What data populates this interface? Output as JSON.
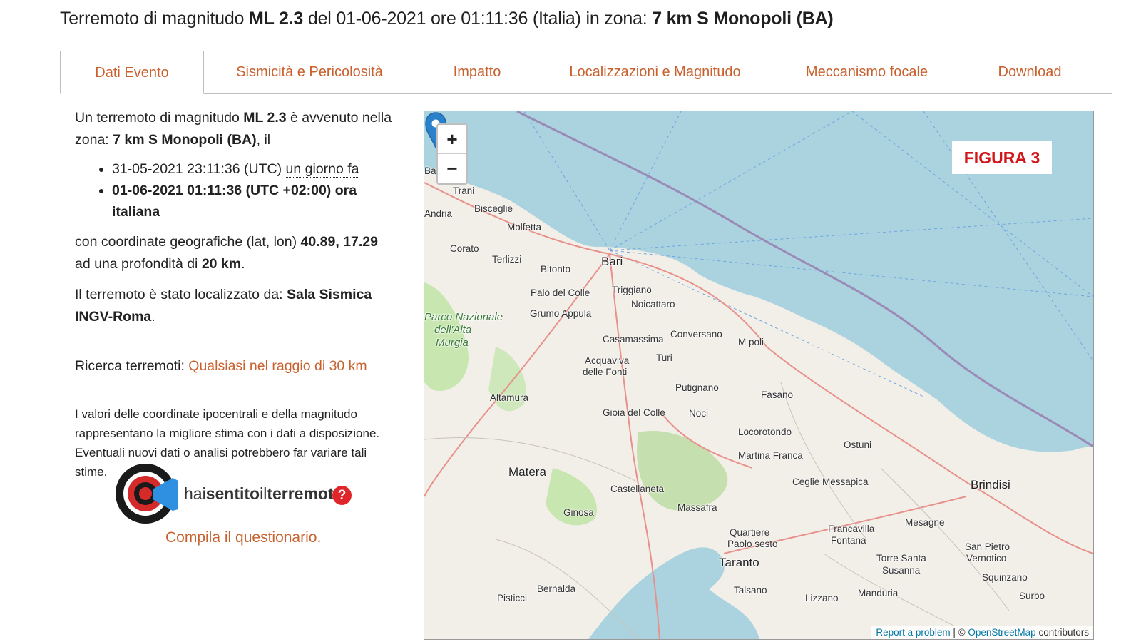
{
  "title": {
    "prefix": "Terremoto di magnitudo ",
    "magnitude": "ML 2.3",
    "middle": " del 01-06-2021 ore 01:11:36 (Italia) in zona: ",
    "zone": "7 km S Monopoli (BA)"
  },
  "tabs": [
    {
      "label": "Dati Evento",
      "active": true
    },
    {
      "label": "Sismicità e Pericolosità"
    },
    {
      "label": "Impatto"
    },
    {
      "label": "Localizzazioni e Magnitudo"
    },
    {
      "label": "Meccanismo focale"
    },
    {
      "label": "Download"
    }
  ],
  "event": {
    "intro_1": "Un terremoto di magnitudo ",
    "magnitude": "ML 2.3",
    "intro_2": " è avvenuto nella zona: ",
    "zone": "7 km S Monopoli (BA)",
    "intro_3": ", il",
    "time_utc": "31-05-2021 23:11:36 (UTC) ",
    "time_ago": "un giorno fa",
    "time_local": "01-06-2021 01:11:36 (UTC +02:00) ora italiana",
    "coords_1": "con coordinate geografiche (lat, lon) ",
    "coords": "40.89, 17.29",
    "coords_2": " ad una profondità di ",
    "depth": "20 km",
    "coords_3": ".",
    "located_1": "Il terremoto è stato localizzato da: ",
    "located_by": "Sala Sismica INGV-Roma",
    "located_3": ".",
    "search_label": "Ricerca terremoti: ",
    "search_link": "Qualsiasi nel raggio di 30 km",
    "disclaimer": "I valori delle coordinate ipocentrali e della magnitudo rappresentano la migliore stima con i dati a disposizione. Eventuali nuovi dati o analisi potrebbero far variare tali stime."
  },
  "hst": {
    "text_hai": "hai",
    "text_sentito": "sentito",
    "text_il": "il",
    "text_terremoto": "terremoto",
    "question": "?",
    "link": "Compila il questionario."
  },
  "map": {
    "zoom_in": "+",
    "zoom_out": "−",
    "figure_label": "FIGURA 3",
    "attribution_report": "Report a problem",
    "attribution_sep": " | © ",
    "attribution_osm": "OpenStreetMap",
    "attribution_tail": " contributors",
    "places": [
      {
        "name": "Trani"
      },
      {
        "name": "Bisceglie"
      },
      {
        "name": "Molfetta"
      },
      {
        "name": "Corato"
      },
      {
        "name": "Terlizzi"
      },
      {
        "name": "Bitonto"
      },
      {
        "name": "Bari"
      },
      {
        "name": "Palo del Colle"
      },
      {
        "name": "Triggiano"
      },
      {
        "name": "Noicattaro"
      },
      {
        "name": "Grumo Appula"
      },
      {
        "name": "Casamassima"
      },
      {
        "name": "Conversano"
      },
      {
        "name": "Turi"
      },
      {
        "name": "Acquaviva"
      },
      {
        "name": "delle Fonti"
      },
      {
        "name": "Putignano"
      },
      {
        "name": "Fasano"
      },
      {
        "name": "Altamura"
      },
      {
        "name": "Gioia del Colle"
      },
      {
        "name": "Noci"
      },
      {
        "name": "Locorotondo"
      },
      {
        "name": "Ostuni"
      },
      {
        "name": "Martina Franca"
      },
      {
        "name": "Matera"
      },
      {
        "name": "Ceglie Messapica"
      },
      {
        "name": "Brindisi"
      },
      {
        "name": "Castellaneta"
      },
      {
        "name": "Massafra"
      },
      {
        "name": "Ginosa"
      },
      {
        "name": "Mesagne"
      },
      {
        "name": "Francavilla"
      },
      {
        "name": "Fontana"
      },
      {
        "name": "Quartiere"
      },
      {
        "name": "Paolo sesto"
      },
      {
        "name": "San Pietro"
      },
      {
        "name": "Vernotico"
      },
      {
        "name": "Taranto"
      },
      {
        "name": "Torre Santa"
      },
      {
        "name": "Susanna"
      },
      {
        "name": "Squinzano"
      },
      {
        "name": "Bernalda"
      },
      {
        "name": "Surbo"
      },
      {
        "name": "Pisticci"
      },
      {
        "name": "Talsano"
      },
      {
        "name": "Lizzano"
      },
      {
        "name": "Manduria"
      },
      {
        "name": "Andria"
      },
      {
        "name": "Barletta"
      },
      {
        "name": "M  poli"
      }
    ],
    "park": [
      "Parco Nazionale",
      "dell'Alta",
      "Murgia"
    ]
  }
}
